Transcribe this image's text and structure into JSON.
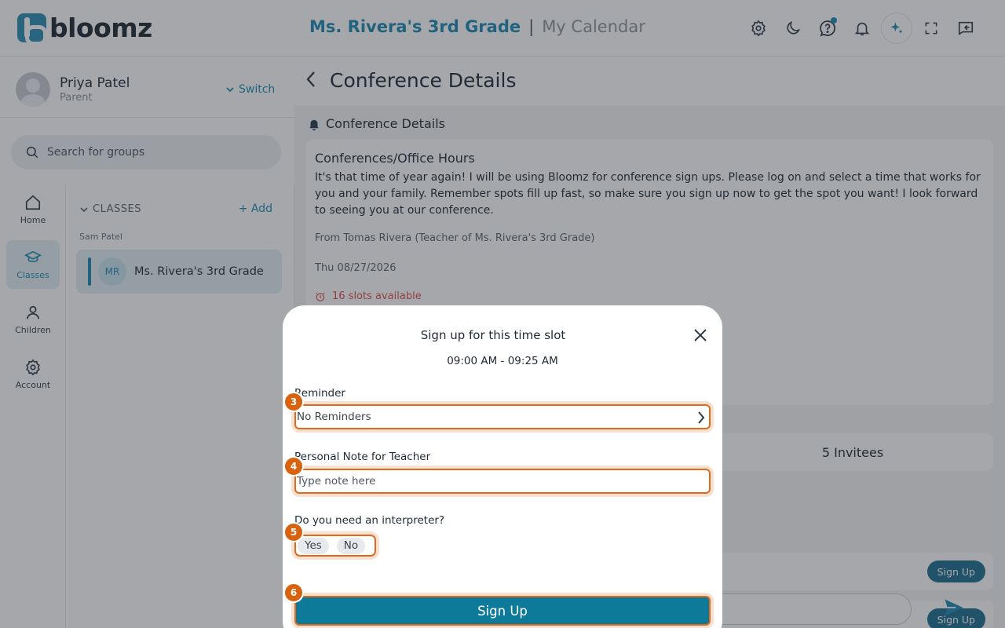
{
  "header": {
    "logo_text": "bloomz",
    "class_name": "Ms. Rivera's 3rd Grade",
    "separator": "|",
    "page_name": "My Calendar",
    "icons": [
      "settings-icon",
      "dark-mode-icon",
      "help-icon",
      "notifications-icon",
      "ai-sparkle-icon",
      "fullscreen-icon",
      "collapse-panel-icon"
    ]
  },
  "profile": {
    "name": "Priya Patel",
    "role": "Parent",
    "switch_label": "Switch"
  },
  "search": {
    "placeholder": "Search for groups"
  },
  "nav": [
    {
      "label": "Home",
      "icon": "home-icon"
    },
    {
      "label": "Classes",
      "icon": "graduation-cap-icon"
    },
    {
      "label": "Children",
      "icon": "person-icon"
    },
    {
      "label": "Account",
      "icon": "gear-icon"
    }
  ],
  "classes": {
    "header": "CLASSES",
    "add_label": "Add",
    "group": "Sam Patel",
    "items": [
      {
        "initials": "MR",
        "name": "Ms. Rivera's 3rd Grade"
      }
    ]
  },
  "main": {
    "title": "Conference Details",
    "section": "Conference Details",
    "card": {
      "title": "Conferences/Office Hours",
      "body": "It's that time of year again! I will be using Bloomz for conference sign ups. Please log on and select a time that works for you and your family. Remember spots fill up fast, so make sure you sign up now to get the spot you want! I look forward to seeing you at our conference.",
      "from": "From Tomas Rivera (Teacher of Ms. Rivera's 3rd Grade)",
      "date": "Thu 08/27/2026",
      "slots": "16 slots available"
    },
    "invitees": "5 Invitees",
    "slot_button": "Sign Up"
  },
  "modal": {
    "title": "Sign up for this time slot",
    "time": "09:00 AM - 09:25 AM",
    "reminder_label": "Reminder",
    "reminder_value": "No Reminders",
    "note_label": "Personal Note for Teacher",
    "note_placeholder": "Type note here",
    "interpreter_label": "Do you need an interpreter?",
    "yes_label": "Yes",
    "no_label": "No",
    "submit_label": "Sign Up",
    "badges": [
      "3",
      "4",
      "5",
      "6"
    ]
  },
  "colors": {
    "brand": "#1d8ab5",
    "highlight": "#e16a1a",
    "submit": "#0e7a9a"
  }
}
